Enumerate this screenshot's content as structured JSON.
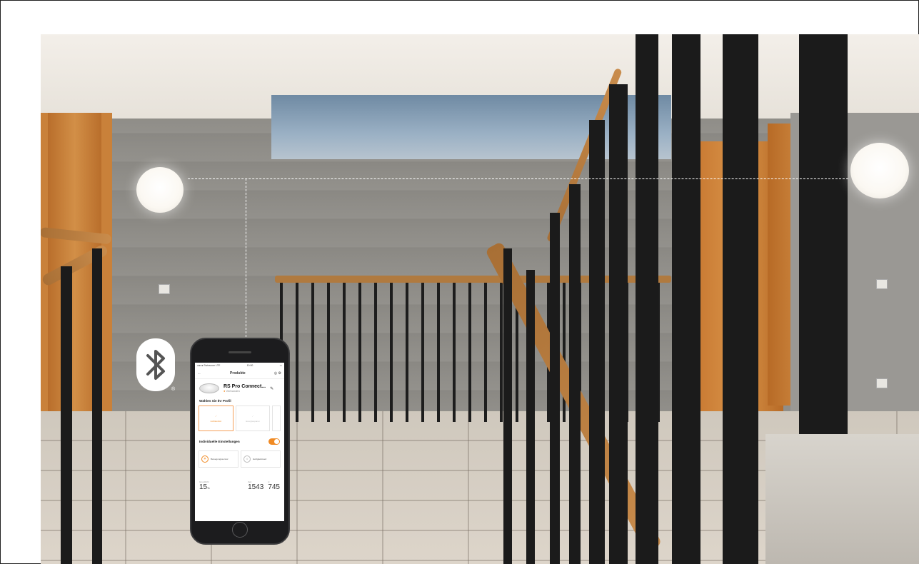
{
  "scene": {
    "description_icons": [
      "bluetooth-icon",
      "ceiling-lamp-left",
      "ceiling-lamp-right"
    ],
    "colors": {
      "accent": "#f08a24",
      "rail_wood": "#b07a3f",
      "door_wood": "#c9813a"
    }
  },
  "bluetooth": {
    "registered_mark": "®"
  },
  "phone": {
    "status_left": "●●●● Swisscom LTE",
    "status_time": "10:00",
    "title": "Produkte",
    "product_name": "RS Pro Connect...",
    "product_status": "Verbunden",
    "profile_heading": "Wählen Sie Ihr Profil",
    "profiles": [
      {
        "label": "Lichtkonfort"
      },
      {
        "label": "Energiesparen"
      },
      {
        "label": ""
      }
    ],
    "individual_heading": "Individuelle Einstellungen",
    "settings": [
      {
        "label": "Bewegungssensor"
      },
      {
        "label": "Helligkeitswert"
      }
    ],
    "values": [
      {
        "label": "Grundlicht",
        "value": "15",
        "unit": "%"
      },
      {
        "label": "Zeit",
        "value": "1543",
        "unit": ""
      },
      {
        "label": "lx",
        "value": "745",
        "unit": ""
      }
    ]
  }
}
